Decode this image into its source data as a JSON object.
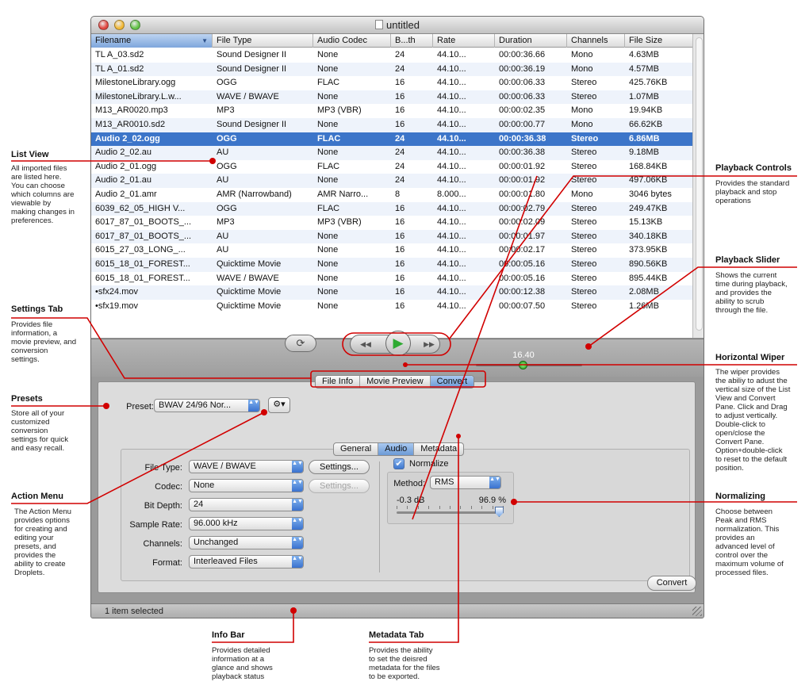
{
  "window": {
    "title": "untitled",
    "light_colors": [
      "#e2463f",
      "#f2b833",
      "#63c447"
    ]
  },
  "file_list": {
    "columns": [
      "Filename",
      "File Type",
      "Audio Codec",
      "B...th",
      "Rate",
      "Duration",
      "Channels",
      "File Size"
    ],
    "sorted_column": "Filename",
    "selected_row": 6,
    "rows": [
      [
        "TL A_03.sd2",
        "Sound Designer II",
        "None",
        "24",
        "44.10...",
        "00:00:36.66",
        "Mono",
        "4.63MB"
      ],
      [
        "TL A_01.sd2",
        "Sound Designer II",
        "None",
        "24",
        "44.10...",
        "00:00:36.19",
        "Mono",
        "4.57MB"
      ],
      [
        "MilestoneLibrary.ogg",
        "OGG",
        "FLAC",
        "16",
        "44.10...",
        "00:00:06.33",
        "Stereo",
        "425.76KB"
      ],
      [
        "MilestoneLibrary.L.w...",
        "WAVE / BWAVE",
        "None",
        "16",
        "44.10...",
        "00:00:06.33",
        "Stereo",
        "1.07MB"
      ],
      [
        "M13_AR0020.mp3",
        "MP3",
        "MP3 (VBR)",
        "16",
        "44.10...",
        "00:00:02.35",
        "Mono",
        "19.94KB"
      ],
      [
        "M13_AR0010.sd2",
        "Sound Designer II",
        "None",
        "16",
        "44.10...",
        "00:00:00.77",
        "Mono",
        "66.62KB"
      ],
      [
        "Audio 2_02.ogg",
        "OGG",
        "FLAC",
        "24",
        "44.10...",
        "00:00:36.38",
        "Stereo",
        "6.86MB"
      ],
      [
        "Audio 2_02.au",
        "AU",
        "None",
        "24",
        "44.10...",
        "00:00:36.38",
        "Stereo",
        "9.18MB"
      ],
      [
        "Audio 2_01.ogg",
        "OGG",
        "FLAC",
        "24",
        "44.10...",
        "00:00:01.92",
        "Stereo",
        "168.84KB"
      ],
      [
        "Audio 2_01.au",
        "AU",
        "None",
        "24",
        "44.10...",
        "00:00:01.92",
        "Stereo",
        "497.06KB"
      ],
      [
        "Audio 2_01.amr",
        "AMR (Narrowband)",
        "AMR Narro...",
        "8",
        "8.000...",
        "00:00:01.80",
        "Mono",
        "3046 bytes"
      ],
      [
        "6039_62_05_HIGH V...",
        "OGG",
        "FLAC",
        "16",
        "44.10...",
        "00:00:02.79",
        "Stereo",
        "249.47KB"
      ],
      [
        "6017_87_01_BOOTS_...",
        "MP3",
        "MP3 (VBR)",
        "16",
        "44.10...",
        "00:00:02.09",
        "Stereo",
        "15.13KB"
      ],
      [
        "6017_87_01_BOOTS_...",
        "AU",
        "None",
        "16",
        "44.10...",
        "00:00:01.97",
        "Stereo",
        "340.18KB"
      ],
      [
        "6015_27_03_LONG_...",
        "AU",
        "None",
        "16",
        "44.10...",
        "00:00:02.17",
        "Stereo",
        "373.95KB"
      ],
      [
        "6015_18_01_FOREST...",
        "Quicktime Movie",
        "None",
        "16",
        "44.10...",
        "00:00:05.16",
        "Stereo",
        "890.56KB"
      ],
      [
        "6015_18_01_FOREST...",
        "WAVE / BWAVE",
        "None",
        "16",
        "44.10...",
        "00:00:05.16",
        "Stereo",
        "895.44KB"
      ],
      [
        "•sfx24.mov",
        "Quicktime Movie",
        "None",
        "16",
        "44.10...",
        "00:00:12.38",
        "Stereo",
        "2.08MB"
      ],
      [
        "•sfx19.mov",
        "Quicktime Movie",
        "None",
        "16",
        "44.10...",
        "00:00:07.50",
        "Stereo",
        "1.26MB"
      ]
    ]
  },
  "playback": {
    "loop_icon": "loop-icon",
    "rewind_glyph": "◀◀",
    "play_glyph": "▶",
    "forward_glyph": "▶▶",
    "slider_value": "16.40",
    "slider_position": 0.45,
    "wiper_glyph": "▴"
  },
  "tabs": {
    "items": [
      "File Info",
      "Movie Preview",
      "Convert"
    ],
    "active": "Convert"
  },
  "convert_pane": {
    "preset_label": "Preset:",
    "preset_value": "BWAV 24/96 Nor...",
    "action_menu_glyph": "⚙▾",
    "sub_tabs": [
      "General",
      "Audio",
      "Metadata"
    ],
    "active_sub_tab": "Audio",
    "file_type_label": "File Type:",
    "file_type_value": "WAVE / BWAVE",
    "codec_label": "Codec:",
    "codec_value": "None",
    "bit_depth_label": "Bit Depth:",
    "bit_depth_value": "24",
    "sample_rate_label": "Sample Rate:",
    "sample_rate_value": "96.000 kHz",
    "channels_label": "Channels:",
    "channels_value": "Unchanged",
    "format_label": "Format:",
    "format_value": "Interleaved Files",
    "settings_label": "Settings...",
    "settings_label_2": "Settings...",
    "normalize_label": "Normalize",
    "normalize_checked": true,
    "method_label": "Method:",
    "method_value": "RMS",
    "norm_db": "-0.3 dB",
    "norm_percent": "96.9 %",
    "norm_level": 0.969,
    "convert_label": "Convert",
    "popup_arrows": "▲▼"
  },
  "info_bar": {
    "status": "1 item selected"
  },
  "annotations": {
    "list_view": {
      "title": "List View",
      "lines": [
        "All imported files",
        "are listed here.",
        "You can choose",
        "which columns are",
        "viewable by",
        "making changes in",
        "preferences."
      ]
    },
    "settings_tab": {
      "title": "Settings Tab",
      "lines": [
        "Provides file",
        "information, a",
        "movie preview, and",
        "conversion",
        "settings."
      ]
    },
    "presets": {
      "title": "Presets",
      "lines": [
        "Store all of your",
        "customized",
        "conversion",
        "settings for quick",
        "and easy recall."
      ]
    },
    "action_menu": {
      "title": "Action Menu",
      "lines": [
        "The Action Menu",
        "provides options",
        "for creating and",
        "editing your",
        "presets, and",
        "provides the",
        "ability to create",
        "Droplets."
      ]
    },
    "playback_controls": {
      "title": "Playback Controls",
      "lines": [
        "Provides the standard",
        "playback and stop",
        "operations"
      ]
    },
    "playback_slider": {
      "title": "Playback Slider",
      "lines": [
        "Shows the current",
        "time during playback,",
        "and provides the",
        "ability to scrub",
        "through the file."
      ]
    },
    "horizontal_wiper": {
      "title": "Horizontal Wiper",
      "lines": [
        "The wiper provides",
        "the abiliy to adust the",
        "vertical size of the List",
        "View and Convert",
        "Pane. Click and Drag",
        "to adjust vertically.",
        "Double-click to",
        "open/close the",
        "Convert Pane.",
        "Option+double-click",
        "to reset to the default",
        "position."
      ]
    },
    "normalizing": {
      "title": "Normalizing",
      "lines": [
        "Choose between",
        "Peak and RMS",
        "normalization.  This",
        "provides an",
        "advanced level of",
        "control over the",
        "maximum volume of",
        "processed files."
      ]
    },
    "info_bar": {
      "title": "Info Bar",
      "lines": [
        "Provides detailed",
        "information at a",
        "glance and shows",
        "playback status"
      ]
    },
    "metadata_tab": {
      "title": "Metadata Tab",
      "lines": [
        "Provides the ability",
        "to set the deisred",
        "metadata for the files",
        "to be exported."
      ]
    }
  },
  "accent_colors": {
    "callout": "#d10000",
    "selection": "#3c75c9",
    "play_green": "#2eaa32"
  }
}
